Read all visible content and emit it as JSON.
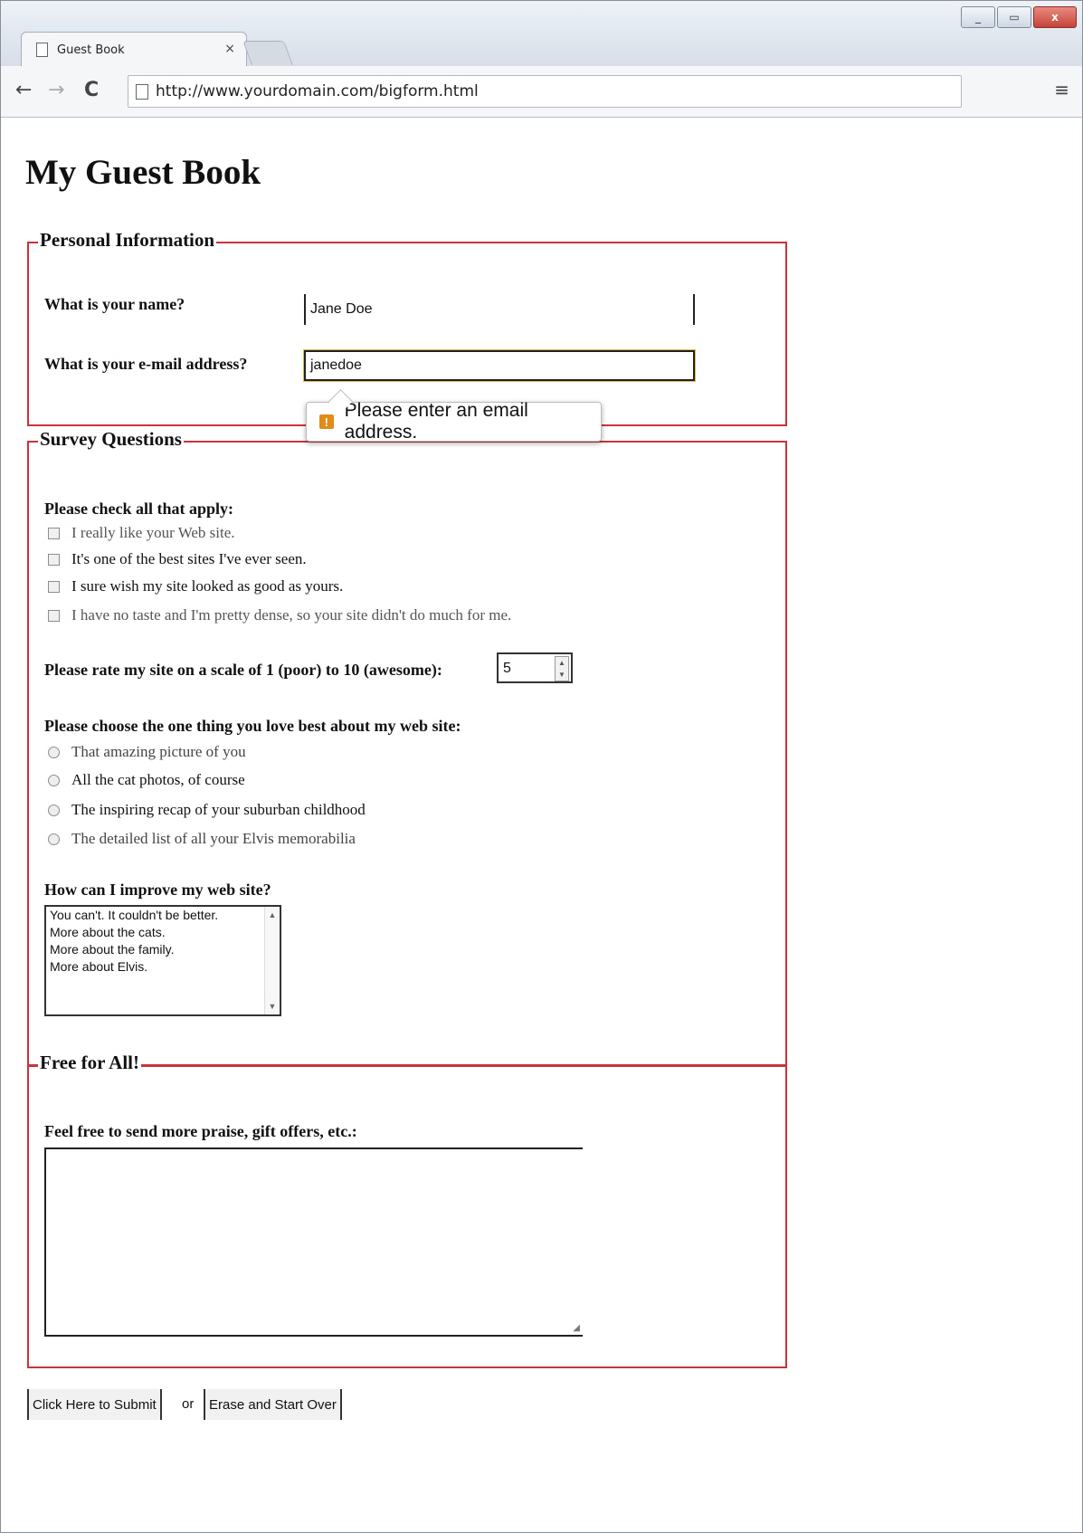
{
  "browser": {
    "tab_title": "Guest Book",
    "tab_close": "×",
    "url": "http://www.yourdomain.com/bigform.html",
    "window_minimize": "_",
    "window_restore": "▭",
    "window_close": "x",
    "back_glyph": "←",
    "forward_glyph": "→",
    "reload_glyph": "C",
    "menu_glyph": "≡"
  },
  "page": {
    "title": "My Guest Book"
  },
  "personal": {
    "legend": "Personal Information",
    "name_label": "What is your name?",
    "name_value": "Jane Doe",
    "email_label": "What is your e-mail address?",
    "email_value": "janedoe",
    "validation_message": "Please enter an email address.",
    "validation_icon": "!"
  },
  "survey": {
    "legend": "Survey Questions",
    "check_heading": "Please check all that apply:",
    "checkboxes": [
      "I really like your Web site.",
      "It's one of the best sites I've ever seen.",
      "I sure wish my site looked as good as yours.",
      "I have no taste and I'm pretty dense, so your site didn't do much for me."
    ],
    "rating_label": "Please rate my site on a scale of 1 (poor) to 10 (awesome):",
    "rating_value": "5",
    "radio_heading": "Please choose the one thing you love best about my web site:",
    "radios": [
      "That amazing picture of you",
      "All the cat photos, of course",
      "The inspiring recap of your suburban childhood",
      "The detailed list of all your Elvis memorabilia"
    ],
    "improve_label": "How can I improve my web site?",
    "improve_options": [
      "You can't. It couldn't be better.",
      "More about the cats.",
      "More about the family.",
      "More about Elvis."
    ]
  },
  "free": {
    "legend": "Free for All!",
    "comments_label": "Feel free to send more praise, gift offers, etc.:"
  },
  "actions": {
    "submit_label": "Click Here to Submit",
    "or_text": "or",
    "reset_label": "Erase and Start Over"
  }
}
